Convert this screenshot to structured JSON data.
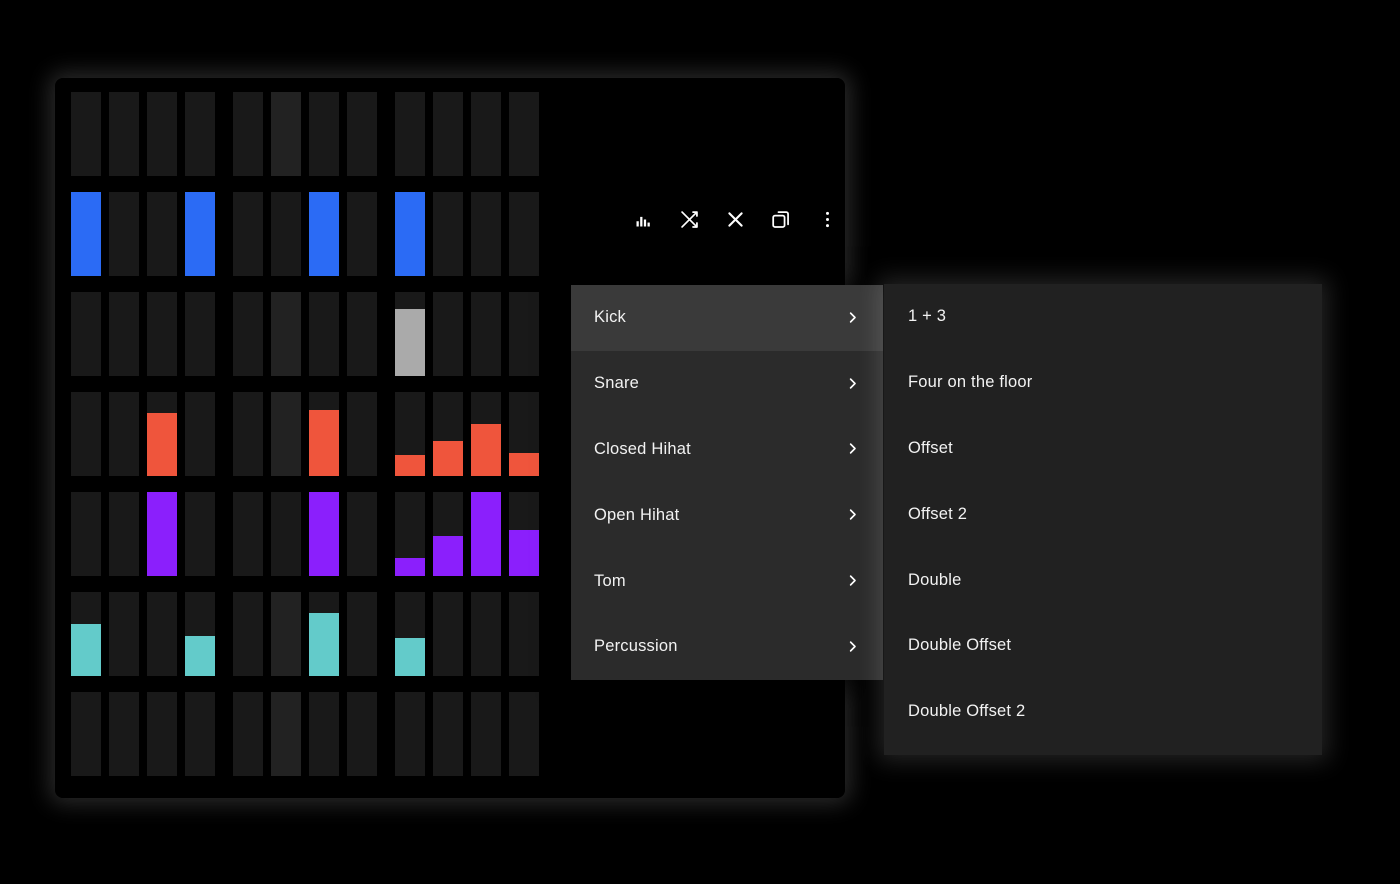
{
  "sequencer": {
    "grid": {
      "rows": 7,
      "groups": 3,
      "steps_per_group": 4,
      "total_steps": 12,
      "empty_color": "#191919",
      "accent_cell_color": "#222222",
      "accent_cells": [
        [
          0,
          5
        ],
        [
          2,
          5
        ],
        [
          3,
          5
        ],
        [
          5,
          5
        ],
        [
          6,
          5
        ]
      ],
      "tracks": [
        {
          "name": "track-1",
          "color": "#191919",
          "steps": [
            0,
            0,
            0,
            0,
            0,
            0,
            0,
            0,
            0,
            0,
            0,
            0
          ]
        },
        {
          "name": "track-2",
          "color": "#2B6BF5",
          "steps": [
            100,
            0,
            0,
            100,
            0,
            0,
            100,
            0,
            100,
            0,
            0,
            0
          ]
        },
        {
          "name": "track-3",
          "color": "#AAAAAA",
          "steps": [
            0,
            0,
            0,
            0,
            0,
            0,
            0,
            0,
            80,
            0,
            0,
            0
          ]
        },
        {
          "name": "track-4",
          "color": "#EF553C",
          "steps": [
            0,
            0,
            75,
            0,
            0,
            0,
            78,
            0,
            25,
            42,
            62,
            27
          ]
        },
        {
          "name": "track-5",
          "color": "#8B1FFC",
          "steps": [
            0,
            0,
            100,
            0,
            0,
            0,
            100,
            0,
            22,
            48,
            100,
            55
          ]
        },
        {
          "name": "track-6",
          "color": "#63CBCA",
          "steps": [
            62,
            0,
            0,
            48,
            0,
            0,
            75,
            0,
            45,
            0,
            0,
            0
          ]
        },
        {
          "name": "track-7",
          "color": "#191919",
          "steps": [
            0,
            0,
            0,
            0,
            0,
            0,
            0,
            0,
            0,
            0,
            0,
            0
          ]
        }
      ]
    },
    "toolbars": [
      {
        "row": 1,
        "dim": false,
        "buttons": [
          "velocity-icon",
          "shuffle-icon",
          "clear-icon",
          "duplicate-icon",
          "more-options-icon"
        ]
      },
      {
        "row": 2,
        "dim": false,
        "buttons": [
          "velocity-icon",
          "shuffle-icon",
          "clear-icon",
          "duplicate-icon",
          "more-options-icon"
        ]
      },
      {
        "row": 7,
        "dim": true,
        "buttons": [
          "velocity-icon",
          "shuffle-icon",
          "clear-icon",
          "duplicate-icon",
          "more-options-icon"
        ]
      }
    ],
    "toolbar_labels": {
      "velocity": "Velocity",
      "shuffle": "Shuffle",
      "clear": "Clear",
      "duplicate": "Duplicate",
      "more": "More options"
    }
  },
  "context_menu": {
    "items": [
      {
        "label": "Kick",
        "active": true,
        "has_submenu": true
      },
      {
        "label": "Snare",
        "active": false,
        "has_submenu": true
      },
      {
        "label": "Closed Hihat",
        "active": false,
        "has_submenu": true
      },
      {
        "label": "Open Hihat",
        "active": false,
        "has_submenu": true
      },
      {
        "label": "Tom",
        "active": false,
        "has_submenu": true
      },
      {
        "label": "Percussion",
        "active": false,
        "has_submenu": true
      }
    ]
  },
  "submenu": {
    "parent": "Kick",
    "items": [
      {
        "label": "1 + 3"
      },
      {
        "label": "Four on the floor"
      },
      {
        "label": "Offset"
      },
      {
        "label": "Offset 2"
      },
      {
        "label": "Double"
      },
      {
        "label": "Double Offset"
      },
      {
        "label": "Double Offset 2"
      }
    ]
  },
  "colors": {
    "background": "#000000",
    "cell_empty": "#191919",
    "cell_accent": "#222222",
    "kick_blue": "#2B6BF5",
    "grey": "#AAAAAA",
    "orange": "#EF553C",
    "purple": "#8B1FFC",
    "teal": "#63CBCA",
    "menu_bg": "#2B2B2B",
    "menu_active": "#3A3A3A",
    "submenu_bg": "#212121",
    "text": "#F2F2F2"
  }
}
